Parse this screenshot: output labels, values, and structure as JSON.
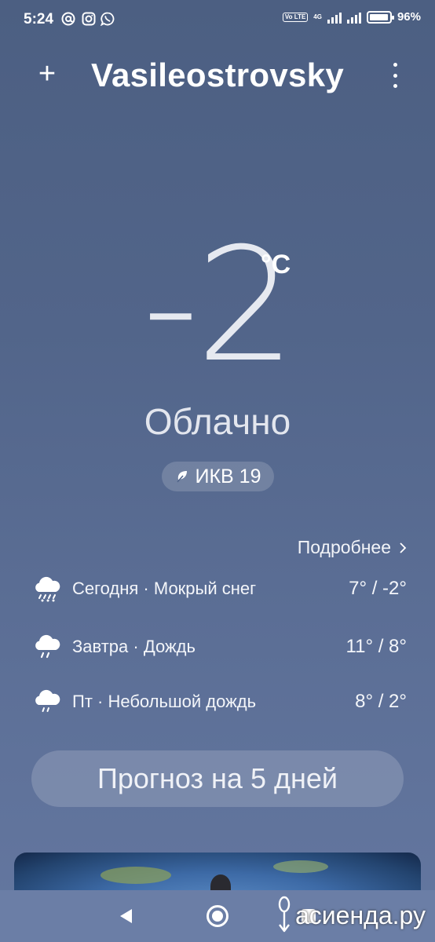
{
  "status_bar": {
    "time": "5:24",
    "notification_icons": [
      "at-icon",
      "instagram-icon",
      "whatsapp-icon"
    ],
    "volte": "Vo LTE",
    "network": "4G",
    "battery": "96%",
    "battery_level": 0.96
  },
  "header": {
    "add_label": "+",
    "city": "Vasileostrovsky"
  },
  "current": {
    "temperature": "-2",
    "unit": "°C",
    "condition": "Облачно",
    "aqi": "ИКВ 19"
  },
  "details_link": "Подробнее",
  "forecast": [
    {
      "icon": "sleet-icon",
      "label": "Сегодня · Мокрый снег",
      "temp": "7° / -2°"
    },
    {
      "icon": "rain-icon",
      "label": "Завтра · Дождь",
      "temp": "11° / 8°"
    },
    {
      "icon": "light-rain-icon",
      "label": "Пт · Небольшой дождь",
      "temp": "8° / 2°"
    }
  ],
  "forecast_button": "Прогноз на 5 дней",
  "watermark": "асиенда.ру",
  "colors": {
    "background_top": "#4c5f82",
    "background_bottom": "#6477a0",
    "text": "#ffffff"
  }
}
